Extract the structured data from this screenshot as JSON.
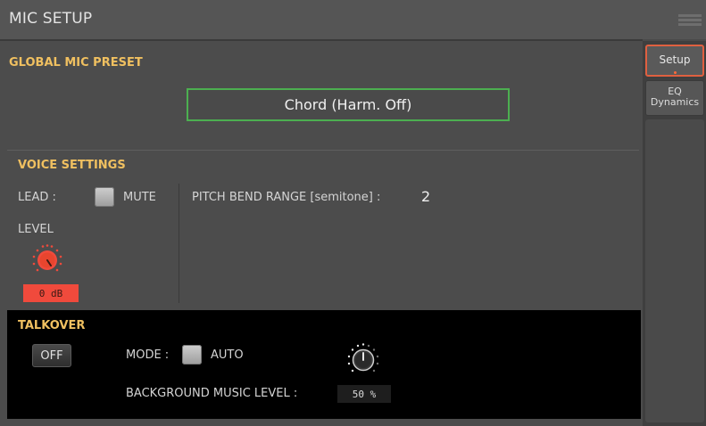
{
  "window": {
    "title": "MIC SETUP",
    "menu_icon": "menu-icon"
  },
  "global": {
    "label": "GLOBAL MIC PRESET",
    "preset": "Chord (Harm. Off)"
  },
  "voice": {
    "label": "VOICE SETTINGS",
    "lead_label": "LEAD :",
    "mute_label": "MUTE",
    "pitch_bend_label": "PITCH BEND RANGE [semitone] :",
    "pitch_bend_value": "2",
    "level_label": "LEVEL",
    "level_value": "0 dB"
  },
  "talkover": {
    "label": "TALKOVER",
    "off_button": "OFF",
    "mode_label": "MODE :",
    "auto_label": "AUTO",
    "bg_label": "BACKGROUND MUSIC LEVEL :",
    "bg_value": "50 %"
  },
  "tabs": {
    "setup": "Setup",
    "eq_line1": "EQ",
    "eq_line2": "Dynamics"
  },
  "colors": {
    "accent": "#f0c060",
    "knob_level": "#f04a3c",
    "preset_border": "#4caf50",
    "active_tab": "#e06040"
  }
}
